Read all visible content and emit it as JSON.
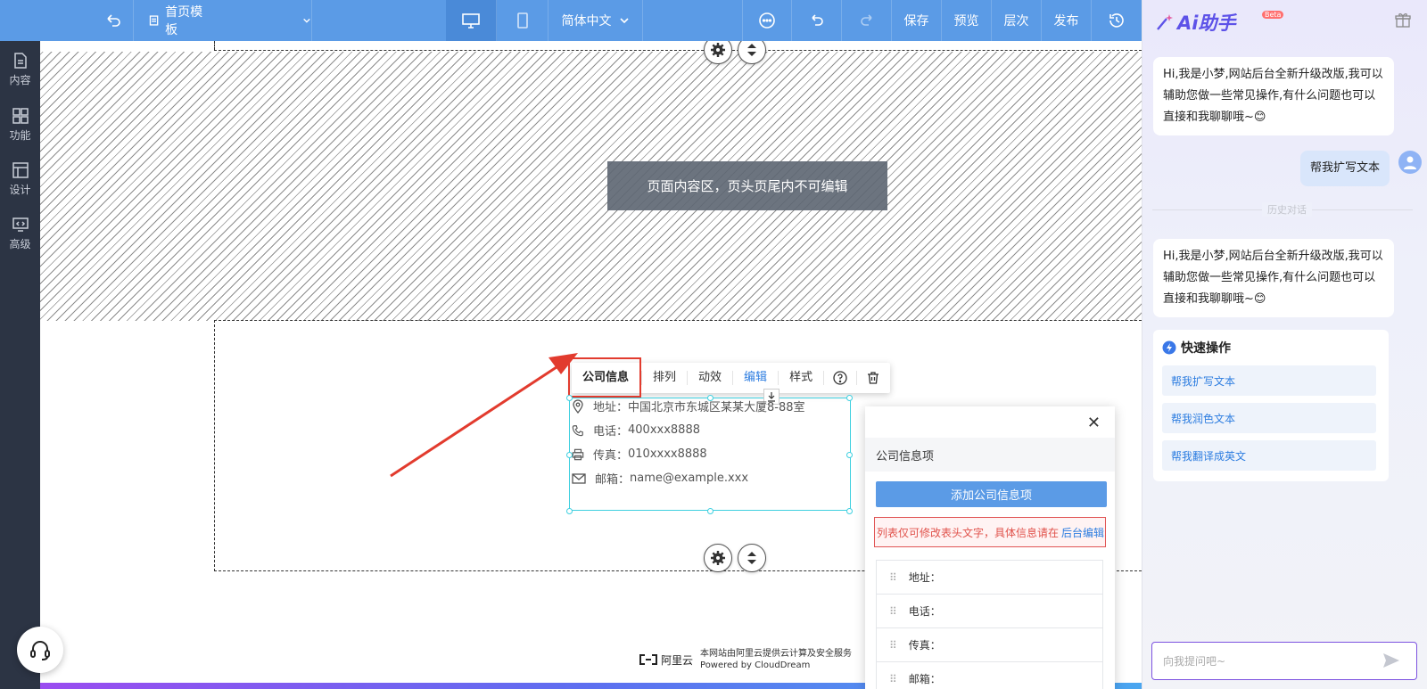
{
  "topbar": {
    "undo_label": "",
    "template_label": "首页模板",
    "language_label": "简体中文",
    "save_label": "保存",
    "preview_label": "预览",
    "layers_label": "层次",
    "publish_label": "发布"
  },
  "sidebar": {
    "items": [
      {
        "label": "内容",
        "icon": "file-icon"
      },
      {
        "label": "功能",
        "icon": "grid-icon"
      },
      {
        "label": "设计",
        "icon": "layout-icon"
      },
      {
        "label": "高级",
        "icon": "code-monitor-icon"
      }
    ]
  },
  "canvas": {
    "notice_text": "页面内容区，页头页尾内不可编辑",
    "footer_brand": "阿里云",
    "footer_line1": "本网站由阿里云提供云计算及安全服务",
    "footer_line2": "Powered by CloudDream"
  },
  "toolbar": {
    "items": [
      "公司信息",
      "排列",
      "动效",
      "编辑",
      "样式"
    ]
  },
  "company_info": {
    "rows": [
      {
        "label": "地址：",
        "value": "中国北京市东城区某某大厦8-88室",
        "icon": "location-icon"
      },
      {
        "label": "电话：",
        "value": "400xxx8888",
        "icon": "phone-icon"
      },
      {
        "label": "传真：",
        "value": "010xxxx8888",
        "icon": "fax-icon"
      },
      {
        "label": "邮箱：",
        "value": "name@example.xxx",
        "icon": "mail-icon"
      }
    ]
  },
  "panel": {
    "title": "公司信息项",
    "add_button": "添加公司信息项",
    "warning": "列表仅可修改表头文字，具体信息请在",
    "warning_link": "后台编辑",
    "items": [
      "地址：",
      "电话：",
      "传真：",
      "邮箱："
    ]
  },
  "ai": {
    "title": "Ai助手",
    "beta": "Beta",
    "greeting1": "Hi,我是小梦,网站后台全新升级改版,我可以辅助您做一些常见操作,有什么问题也可以直接和我聊聊哦~😊",
    "user_msg": "帮我扩写文本",
    "history_label": "历史对话",
    "greeting2": "Hi,我是小梦,网站后台全新升级改版,我可以辅助您做一些常见操作,有什么问题也可以直接和我聊聊哦~😊",
    "quick_title": "快速操作",
    "quick_actions": [
      "帮我扩写文本",
      "帮我润色文本",
      "帮我翻译成英文"
    ],
    "input_placeholder": "向我提问吧~"
  },
  "colors": {
    "topbar": "#5b9be6",
    "sidebar": "#2c3444",
    "accent_red": "#e23b2e",
    "selection": "#3fd0e0",
    "link_blue": "#2d7de0"
  }
}
